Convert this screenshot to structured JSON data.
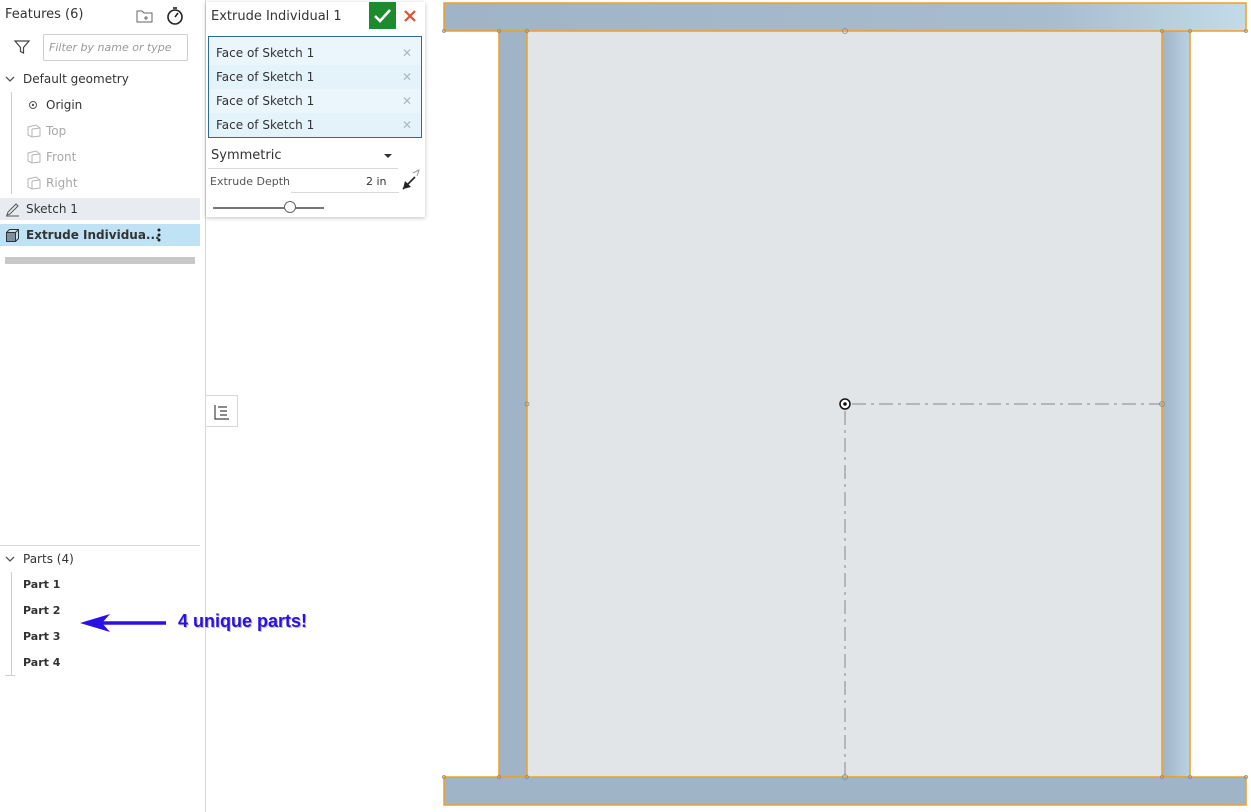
{
  "features_panel": {
    "title": "Features (6)",
    "filter_placeholder": "Filter by name or type",
    "default_geometry_label": "Default geometry",
    "items": [
      {
        "label": "Origin"
      },
      {
        "label": "Top"
      },
      {
        "label": "Front"
      },
      {
        "label": "Right"
      },
      {
        "label": "Sketch 1"
      },
      {
        "label": "Extrude Individua..."
      }
    ]
  },
  "parts_panel": {
    "title": "Parts (4)",
    "parts": [
      "Part 1",
      "Part 2",
      "Part 3",
      "Part 4"
    ]
  },
  "dialog": {
    "title": "Extrude Individual 1",
    "selections": [
      "Face of Sketch 1",
      "Face of Sketch 1",
      "Face of Sketch 1",
      "Face of Sketch 1"
    ],
    "end_type": "Symmetric",
    "depth_label": "Extrude Depth",
    "depth_value": "2 in"
  },
  "annotation": {
    "text": "4 unique parts!",
    "color": "#2a10e6"
  },
  "colors": {
    "accent_ok": "#1d8a2e",
    "cancel": "#e0502a",
    "selected_row": "#bfe3f5",
    "part_highlight": "#f5a623",
    "part_fill": "#9fb6c9",
    "face_fill": "#e2e5e8"
  }
}
